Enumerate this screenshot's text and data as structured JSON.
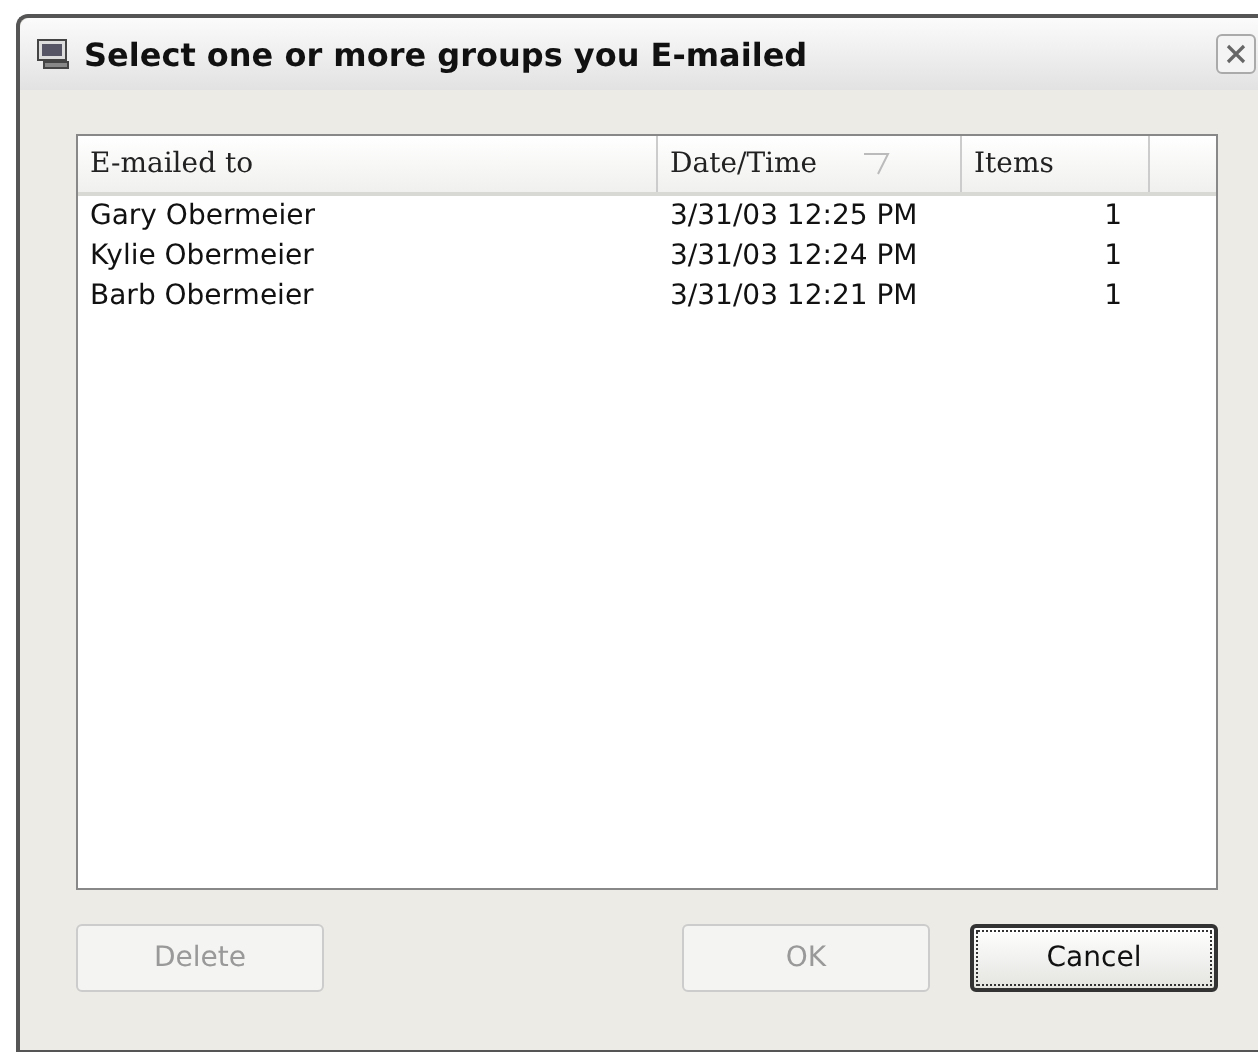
{
  "window": {
    "title": "Select one or more groups you E-mailed"
  },
  "table": {
    "columns": [
      {
        "label": "E-mailed to",
        "sorted": false
      },
      {
        "label": "Date/Time",
        "sorted": true
      },
      {
        "label": "Items",
        "sorted": false
      }
    ],
    "rows": [
      {
        "cells": [
          "Gary Obermeier",
          "3/31/03 12:25 PM",
          "1"
        ]
      },
      {
        "cells": [
          "Kylie Obermeier",
          "3/31/03 12:24 PM",
          "1"
        ]
      },
      {
        "cells": [
          "Barb Obermeier",
          "3/31/03 12:21 PM",
          "1"
        ]
      }
    ]
  },
  "buttons": [
    {
      "label": "Delete",
      "disabled": true,
      "default": false
    },
    {
      "label": "OK",
      "disabled": true,
      "default": false
    },
    {
      "label": "Cancel",
      "disabled": false,
      "default": true
    }
  ]
}
